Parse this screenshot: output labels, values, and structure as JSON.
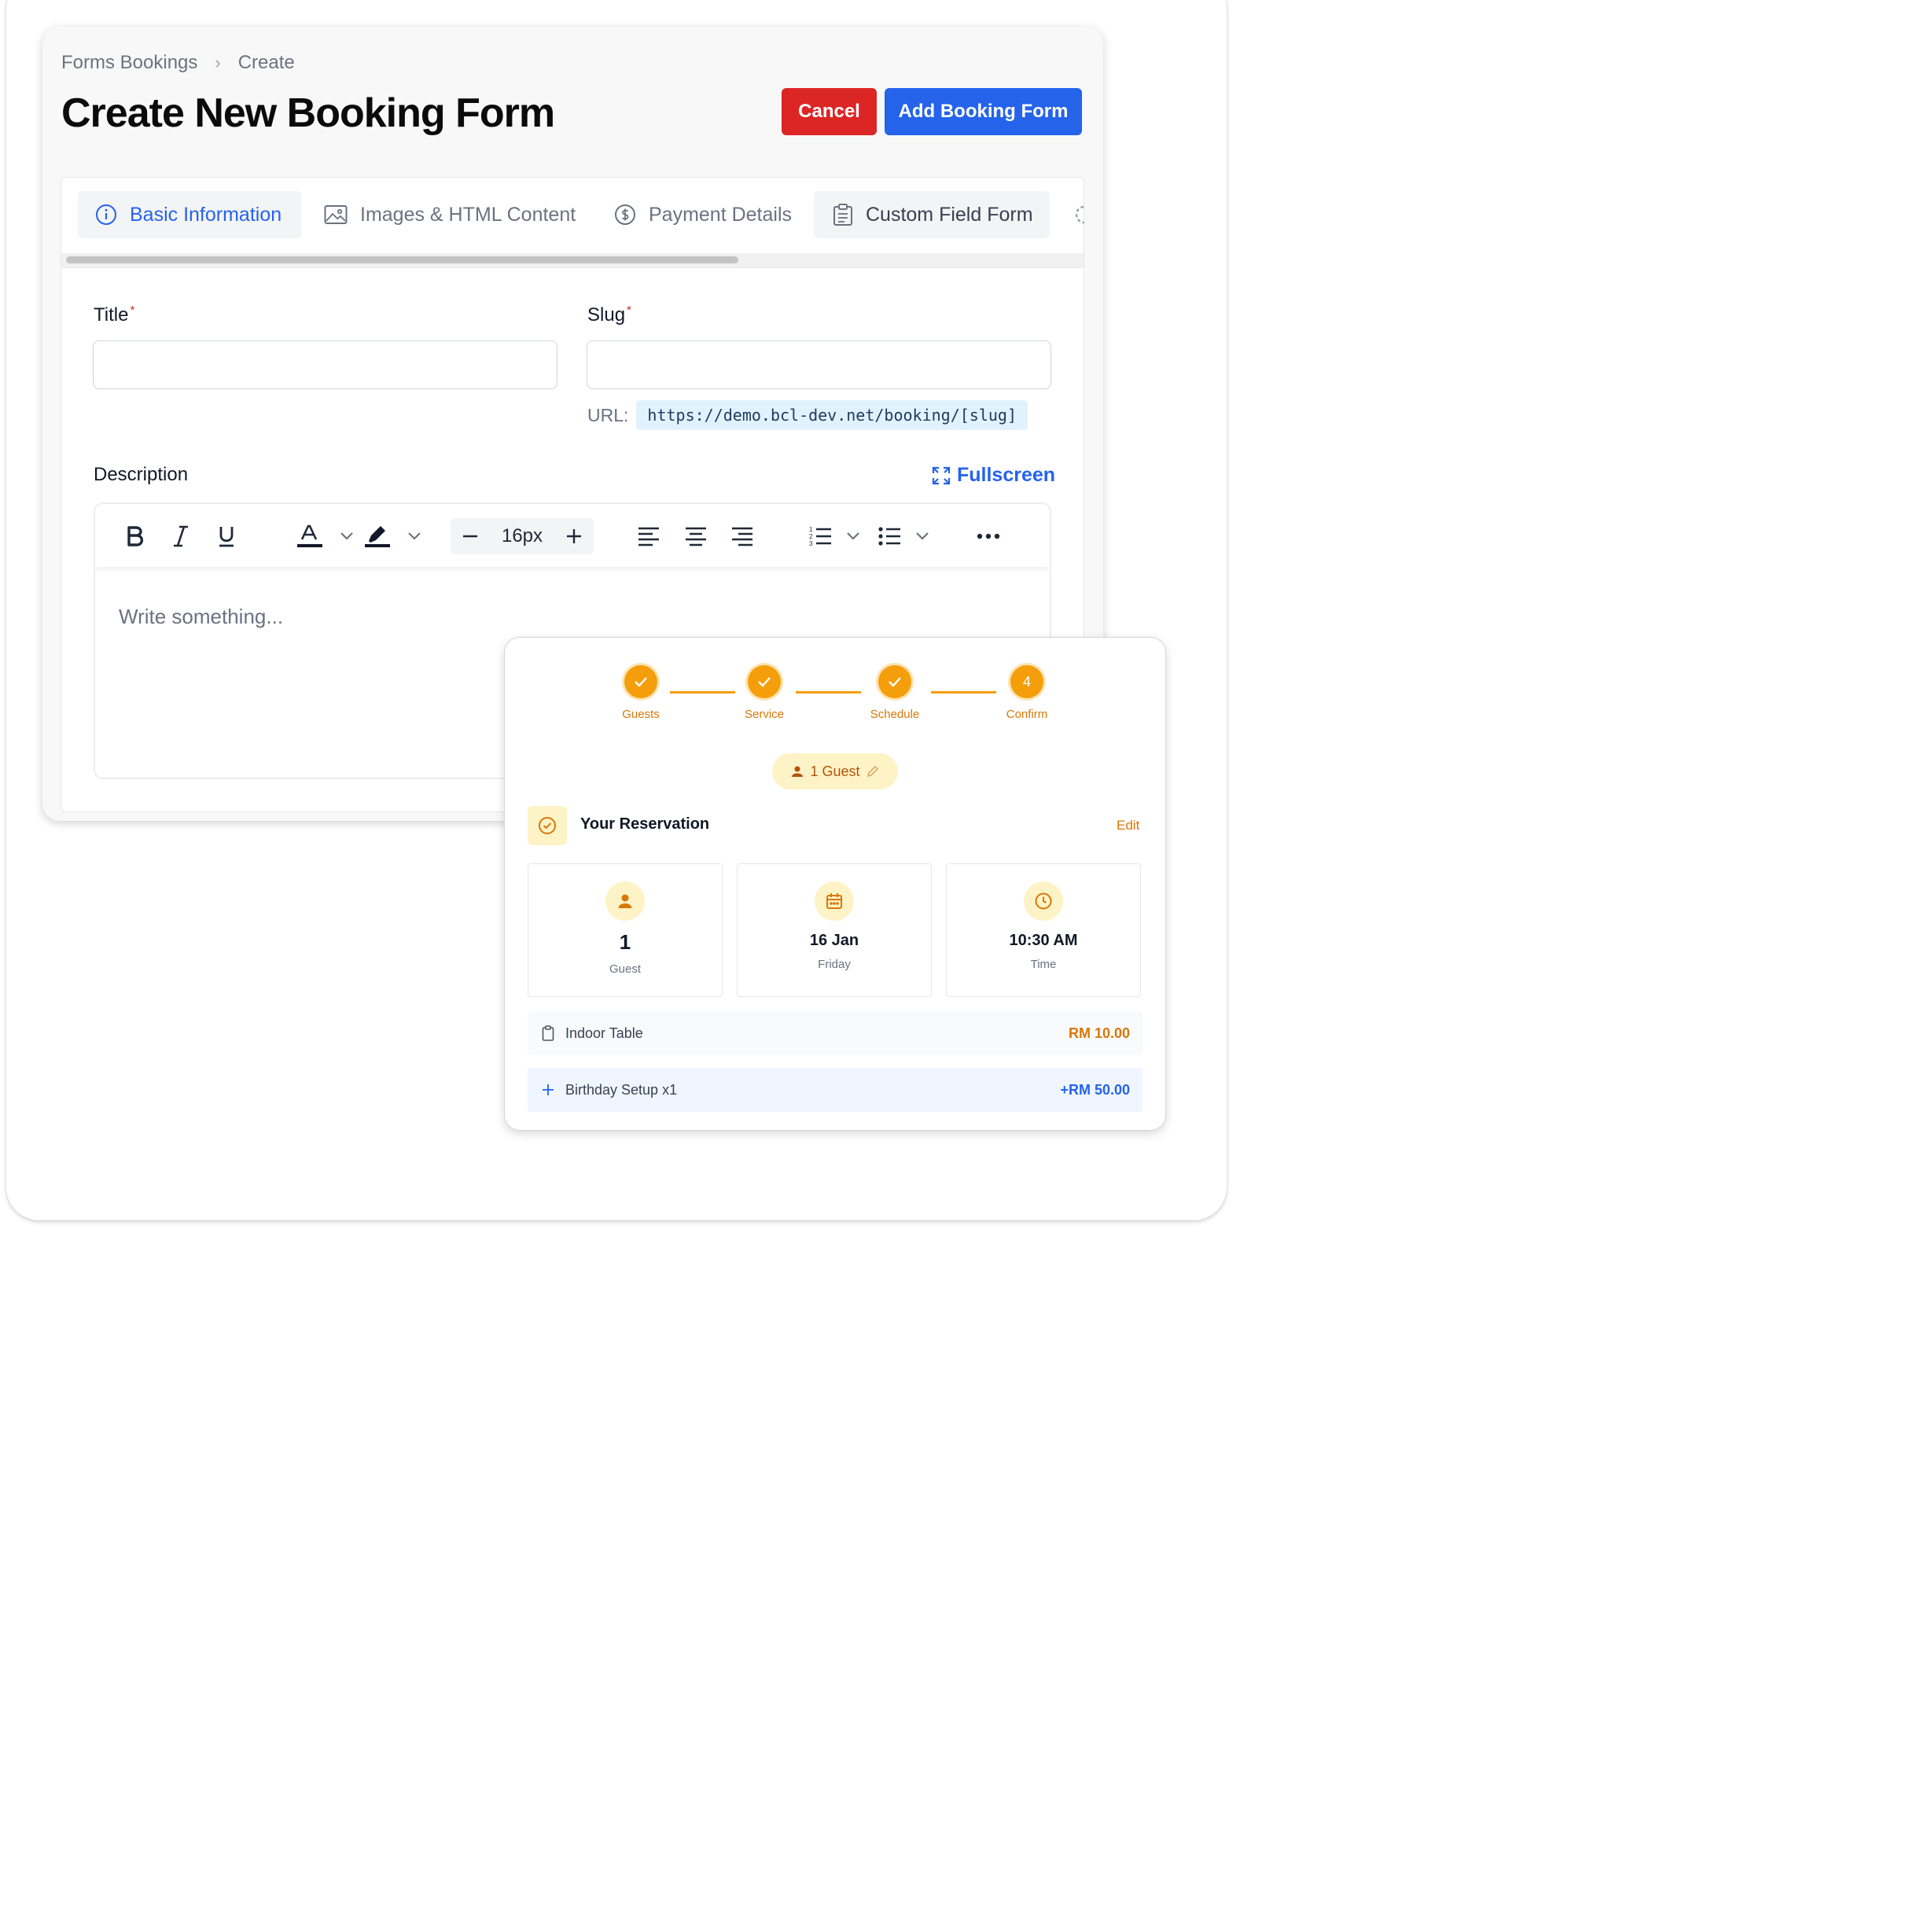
{
  "breadcrumb": {
    "parent": "Forms Bookings",
    "separator": "›",
    "current": "Create"
  },
  "page_title": "Create New Booking Form",
  "actions": {
    "cancel": "Cancel",
    "add": "Add Booking Form"
  },
  "tabs": [
    {
      "label": "Basic Information",
      "icon": "info-icon",
      "active": true
    },
    {
      "label": "Images & HTML Content",
      "icon": "image-icon"
    },
    {
      "label": "Payment Details",
      "icon": "dollar-icon"
    },
    {
      "label": "Custom Field Form",
      "icon": "clipboard-icon"
    }
  ],
  "form": {
    "title_label": "Title",
    "slug_label": "Slug",
    "required_mark": "*",
    "title_value": "",
    "slug_value": "",
    "url_label": "URL:",
    "url_value": "https://demo.bcl-dev.net/booking/[slug]",
    "description_label": "Description",
    "fullscreen_label": "Fullscreen",
    "font_size": "16px",
    "editor_placeholder": "Write something..."
  },
  "overlay": {
    "steps": [
      {
        "label": "Guests",
        "state": "done"
      },
      {
        "label": "Service",
        "state": "done"
      },
      {
        "label": "Schedule",
        "state": "done"
      },
      {
        "label": "Confirm",
        "number": "4",
        "state": "current"
      }
    ],
    "guest_pill": "1 Guest",
    "reservation_title": "Your Reservation",
    "edit": "Edit",
    "cards": [
      {
        "value": "1",
        "caption": "Guest",
        "icon": "user-icon"
      },
      {
        "value": "16 Jan",
        "caption": "Friday",
        "icon": "calendar-icon"
      },
      {
        "value": "10:30 AM",
        "caption": "Time",
        "icon": "clock-icon"
      }
    ],
    "items": [
      {
        "label": "Indoor Table",
        "amount": "RM 10.00",
        "icon": "clipboard-icon"
      },
      {
        "label": "Birthday Setup x1",
        "amount": "+RM 50.00",
        "icon": "plus-icon"
      }
    ]
  },
  "colors": {
    "primary": "#2563eb",
    "danger": "#dc2626",
    "accent": "#f59e0b"
  }
}
